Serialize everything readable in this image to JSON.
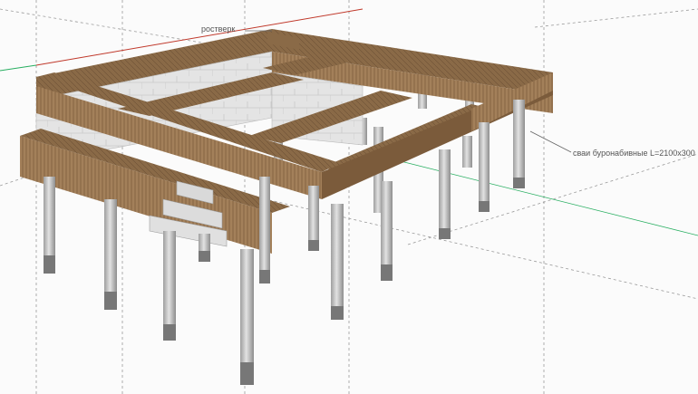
{
  "annotations": {
    "grillage": "ростверк",
    "piles": "сваи буронабивные L=2100x300"
  },
  "colors": {
    "background": "#fbfbfb",
    "axis_red": "#c0392b",
    "axis_green": "#27ae60",
    "guide": "#9a9a9a",
    "beam_top": "#8a6a47",
    "beam_side": "#a3805a",
    "block": "#e6e6e6",
    "pile": "#cfcfcf",
    "pile_tip": "#777777"
  },
  "icons": {
    "axes": "model-axes-icon"
  }
}
